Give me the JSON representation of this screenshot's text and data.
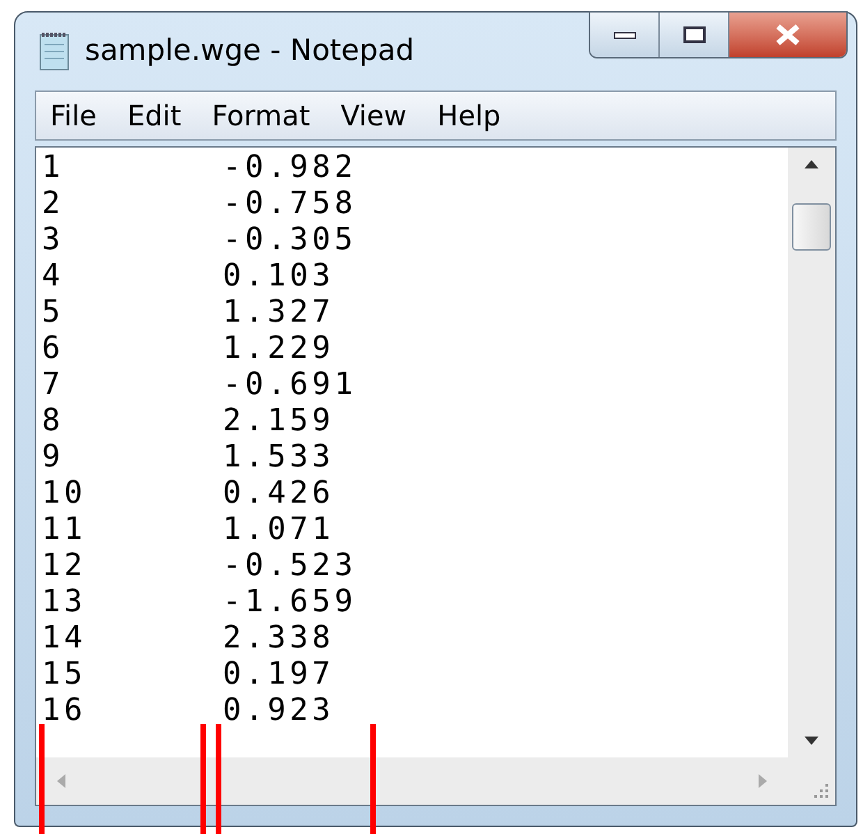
{
  "window": {
    "title": "sample.wge - Notepad"
  },
  "menu": [
    "File",
    "Edit",
    "Format",
    "View",
    "Help"
  ],
  "lines": [
    {
      "column_1": "1",
      "column_2": "-0.982"
    },
    {
      "column_1": "2",
      "column_2": "-0.758"
    },
    {
      "column_1": "3",
      "column_2": "-0.305"
    },
    {
      "column_1": "4",
      "column_2": "0.103"
    },
    {
      "column_1": "5",
      "column_2": "1.327"
    },
    {
      "column_1": "6",
      "column_2": "1.229"
    },
    {
      "column_1": "7",
      "column_2": "-0.691"
    },
    {
      "column_1": "8",
      "column_2": "2.159"
    },
    {
      "column_1": "9",
      "column_2": "1.533"
    },
    {
      "column_1": "10",
      "column_2": "0.426"
    },
    {
      "column_1": "11",
      "column_2": "1.071"
    },
    {
      "column_1": "12",
      "column_2": "-0.523"
    },
    {
      "column_1": "13",
      "column_2": "-1.659"
    },
    {
      "column_1": "14",
      "column_2": "2.338"
    },
    {
      "column_1": "15",
      "column_2": "0.197"
    },
    {
      "column_1": "16",
      "column_2": "0.923"
    }
  ]
}
